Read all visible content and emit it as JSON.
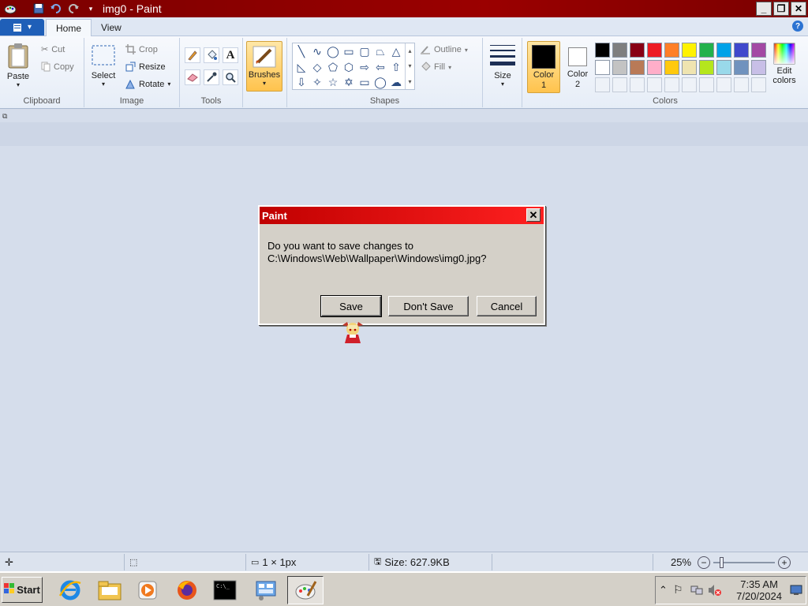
{
  "window": {
    "title": "img0 - Paint"
  },
  "tabs": {
    "home": "Home",
    "view": "View"
  },
  "clipboard": {
    "paste": "Paste",
    "cut": "Cut",
    "copy": "Copy",
    "label": "Clipboard"
  },
  "image": {
    "select": "Select",
    "crop": "Crop",
    "resize": "Resize",
    "rotate": "Rotate",
    "label": "Image"
  },
  "tools": {
    "label": "Tools"
  },
  "brushes": {
    "label": "Brushes"
  },
  "shapes": {
    "outline": "Outline",
    "fill": "Fill",
    "label": "Shapes"
  },
  "size": {
    "label": "Size"
  },
  "colors": {
    "color1": "Color 1",
    "color2": "Color 2",
    "edit": "Edit colors",
    "label": "Colors",
    "palette_row1": [
      "#000000",
      "#7f7f7f",
      "#880015",
      "#ed1c24",
      "#ff7f27",
      "#fff200",
      "#22b14c",
      "#00a2e8",
      "#3f48cc",
      "#a349a4"
    ],
    "palette_row2": [
      "#ffffff",
      "#c3c3c3",
      "#b97a57",
      "#ffaec9",
      "#ffc90e",
      "#efe4b0",
      "#b5e61d",
      "#99d9ea",
      "#7092be",
      "#c8bfe7"
    ],
    "color1_value": "#000000",
    "color2_value": "#ffffff"
  },
  "dialog": {
    "title": "Paint",
    "message_line1": "Do you want to save changes to",
    "message_line2": "C:\\Windows\\Web\\Wallpaper\\Windows\\img0.jpg?",
    "save": "Save",
    "dont_save": "Don't Save",
    "cancel": "Cancel"
  },
  "status": {
    "selection_size": "1 × 1px",
    "file_size": "Size: 627.9KB",
    "zoom": "25%"
  },
  "taskbar": {
    "start": "Start",
    "time": "7:35 AM",
    "date": "7/20/2024"
  }
}
